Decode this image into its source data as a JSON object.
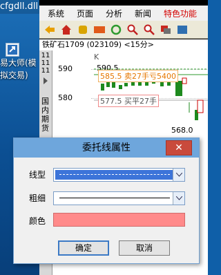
{
  "desktop": {
    "file_name": "cfgdll.dll",
    "shortcut_label": "易大师(模拟交易)"
  },
  "menu": {
    "items": [
      "系统",
      "页面",
      "分析",
      "新闻"
    ],
    "hot_item": "特色功能"
  },
  "chart": {
    "title": "铁矿石1709 (023109) <15分>",
    "k_label": "K",
    "y_ticks": [
      "590",
      "580"
    ],
    "annotations": {
      "high": "590.5",
      "sell": "585.5 卖27手亏5400",
      "buy": "577.5 买平27手",
      "low": "568.0"
    },
    "side_numbers": [
      "11",
      "11",
      "11"
    ],
    "side_text": "国内期货"
  },
  "dialog": {
    "title": "委托线属性",
    "close": "✕",
    "line_type_label": "线型",
    "thickness_label": "粗细",
    "color_label": "颜色",
    "color_value": "#ff8a8a",
    "ok_label": "确定",
    "cancel_label": "取消"
  }
}
